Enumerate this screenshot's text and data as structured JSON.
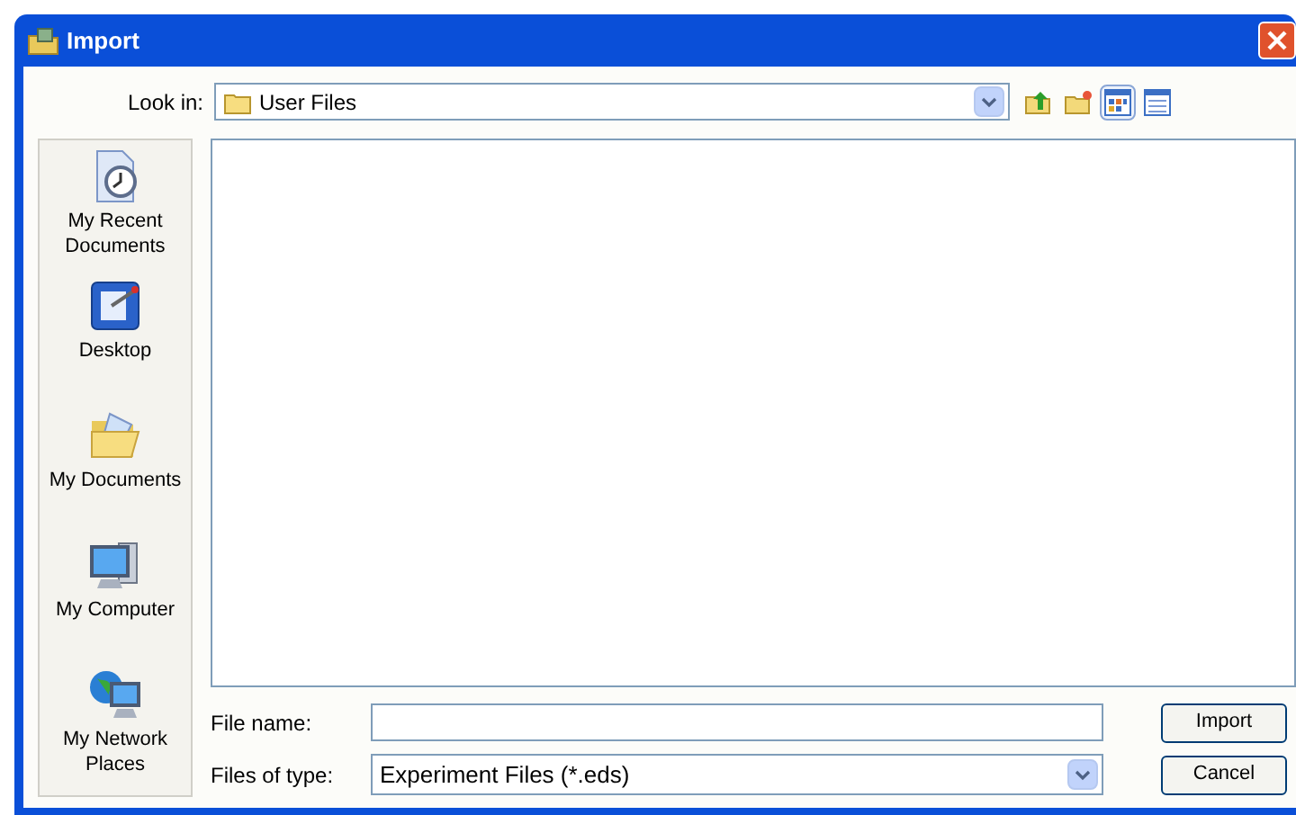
{
  "window": {
    "title": "Import"
  },
  "look_in": {
    "label": "Look in:",
    "value": "User Files"
  },
  "view_buttons": [
    {
      "kind": "up",
      "selected": false
    },
    {
      "kind": "new-folder",
      "selected": false
    },
    {
      "kind": "icons",
      "selected": true
    },
    {
      "kind": "details",
      "selected": false
    }
  ],
  "places": [
    {
      "kind": "recent",
      "label": "My Recent Documents"
    },
    {
      "kind": "desktop",
      "label": "Desktop"
    },
    {
      "kind": "documents",
      "label": "My Documents"
    },
    {
      "kind": "computer",
      "label": "My Computer"
    },
    {
      "kind": "network",
      "label": "My Network Places"
    }
  ],
  "file_name": {
    "label": "File name:"
  },
  "file_type": {
    "label": "Files of type:",
    "value": "Experiment Files (*.eds)"
  },
  "buttons": [
    "Import",
    "Cancel"
  ]
}
